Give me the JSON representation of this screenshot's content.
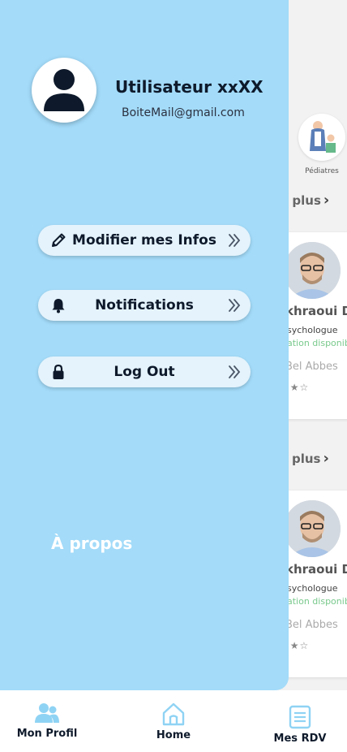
{
  "profile": {
    "name": "Utilisateur xxXX",
    "email": "BoiteMail@gmail.com"
  },
  "menu": [
    {
      "label": "Modifier mes Infos",
      "icon": "pencil-icon"
    },
    {
      "label": "Notifications",
      "icon": "bell-icon"
    },
    {
      "label": "Log Out",
      "icon": "lock-icon"
    }
  ],
  "about_label": "À propos",
  "background": {
    "category_label": "Pédiatres",
    "see_more_1": "e plus",
    "see_more_2": "plus",
    "cards": [
      {
        "name": "khraoui Da",
        "specialty": "sychologue",
        "availability": "ation disponib",
        "city": "Bel Abbes",
        "stars": "★★☆"
      },
      {
        "name": "khraoui Da",
        "specialty": "sychologue",
        "availability": "ation disponib",
        "city": "Bel Abbes",
        "stars": "★★☆"
      }
    ]
  },
  "bottom_nav": {
    "profile": "Mon Profil",
    "home": "Home",
    "appointments": "Mes RDV"
  },
  "colors": {
    "drawer_bg": "#a3dbf9",
    "button_bg": "#e4f3fc",
    "nav_icon": "#8fd3f4",
    "text_dark": "#0e1a2b"
  }
}
